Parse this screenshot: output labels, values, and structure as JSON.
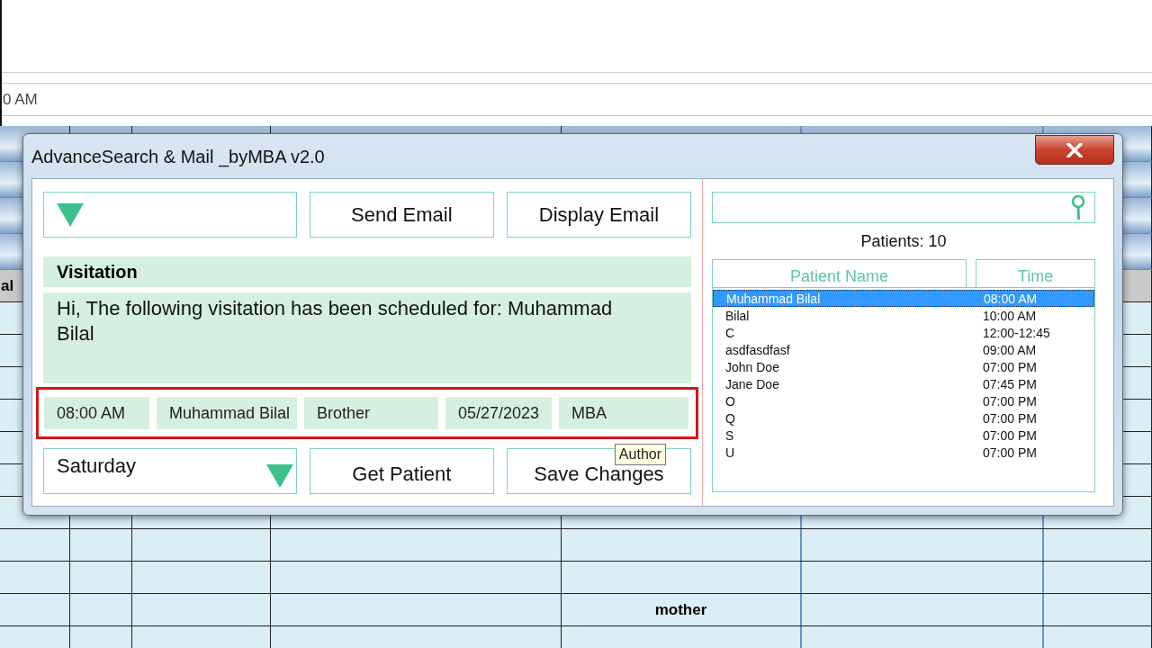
{
  "sheet": {
    "time_cell": "0 AM",
    "header_cell": "al",
    "name_cell": "mother"
  },
  "window": {
    "title": "AdvanceSearch & Mail _byMBA v2.0"
  },
  "email_buttons": [
    "Send Email",
    "Display Email"
  ],
  "visitation": {
    "heading": "Visitation",
    "message": "Hi, The following visitation has been scheduled for: Muhammad Bilal"
  },
  "details": [
    "08:00 AM",
    "Muhammad Bilal",
    "Brother",
    "05/27/2023",
    "MBA"
  ],
  "day_dropdown": {
    "value": "Saturday"
  },
  "action_buttons": [
    "Get Patient",
    "Save Changes"
  ],
  "tooltip": "Author",
  "patient_count": "Patients: 10",
  "patients": {
    "columns": [
      "Patient Name",
      "Time"
    ],
    "rows": [
      {
        "name": "Muhammad Bilal",
        "time": "08:00 AM",
        "selected": true
      },
      {
        "name": "Bilal",
        "time": "10:00 AM",
        "selected": false
      },
      {
        "name": "C",
        "time": "12:00-12:45",
        "selected": false
      },
      {
        "name": "asdfasdfasf",
        "time": "09:00 AM",
        "selected": false
      },
      {
        "name": "John Doe",
        "time": "07:00 PM",
        "selected": false
      },
      {
        "name": "Jane Doe",
        "time": "07:45 PM",
        "selected": false
      },
      {
        "name": "O",
        "time": "07:00 PM",
        "selected": false
      },
      {
        "name": "Q",
        "time": "07:00 PM",
        "selected": false
      },
      {
        "name": "S",
        "time": "07:00 PM",
        "selected": false
      },
      {
        "name": "U",
        "time": "07:00 PM",
        "selected": false
      }
    ]
  }
}
